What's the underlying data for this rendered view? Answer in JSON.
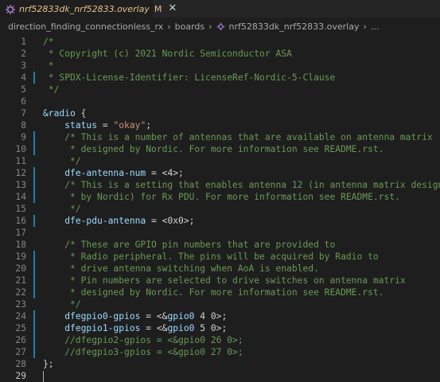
{
  "tab": {
    "filename": "nrf52833dk_nrf52833.overlay",
    "modified": "M",
    "close": "✕"
  },
  "breadcrumb": {
    "items": [
      "direction_finding_connectionless_rx",
      "boards",
      "nrf52833dk_nrf52833.overlay",
      "..."
    ],
    "separator": "›"
  },
  "editor": {
    "line_numbers": [
      "1",
      "2",
      "3",
      "4",
      "5",
      "6",
      "7",
      "8",
      "9",
      "10",
      "11",
      "12",
      "13",
      "14",
      "15",
      "16",
      "17",
      "18",
      "19",
      "20",
      "21",
      "22",
      "23",
      "24",
      "25",
      "26",
      "27",
      "28",
      "29"
    ],
    "lines": [
      "/*",
      " * Copyright (c) 2021 Nordic Semiconductor ASA",
      " *",
      " * SPDX-License-Identifier: LicenseRef-Nordic-5-Clause",
      " */",
      "",
      "&radio {",
      "    status = \"okay\";",
      "    /* This is a number of antennas that are available on antenna matrix",
      "     * designed by Nordic. For more information see README.rst.",
      "     */",
      "    dfe-antenna-num = <4>;",
      "    /* This is a setting that enables antenna 12 (in antenna matrix designed",
      "     * by Nordic) for Rx PDU. For more information see README.rst.",
      "     */",
      "    dfe-pdu-antenna = <0x0>;",
      "",
      "    /* These are GPIO pin numbers that are provided to",
      "     * Radio peripheral. The pins will be acquired by Radio to",
      "     * drive antenna switching when AoA is enabled.",
      "     * Pin numbers are selected to drive switches on antenna matrix",
      "     * designed by Nordic. For more information see README.rst.",
      "     */",
      "    dfegpio0-gpios = <&gpio0 4 0>;",
      "    dfegpio1-gpios = <&gpio0 5 0>;",
      "    //dfegpio2-gpios = <&gpio0 26 0>;",
      "    //dfegpio3-gpios = <&gpio0 27 0>;",
      "};",
      ""
    ],
    "active_line": 29,
    "colors": {
      "background": "#1e1e1e",
      "comment": "#6a9955",
      "property": "#9cdcfe",
      "string": "#ce9178",
      "text": "#d4d4d4",
      "modified_gutter": "#1b81a8"
    }
  }
}
